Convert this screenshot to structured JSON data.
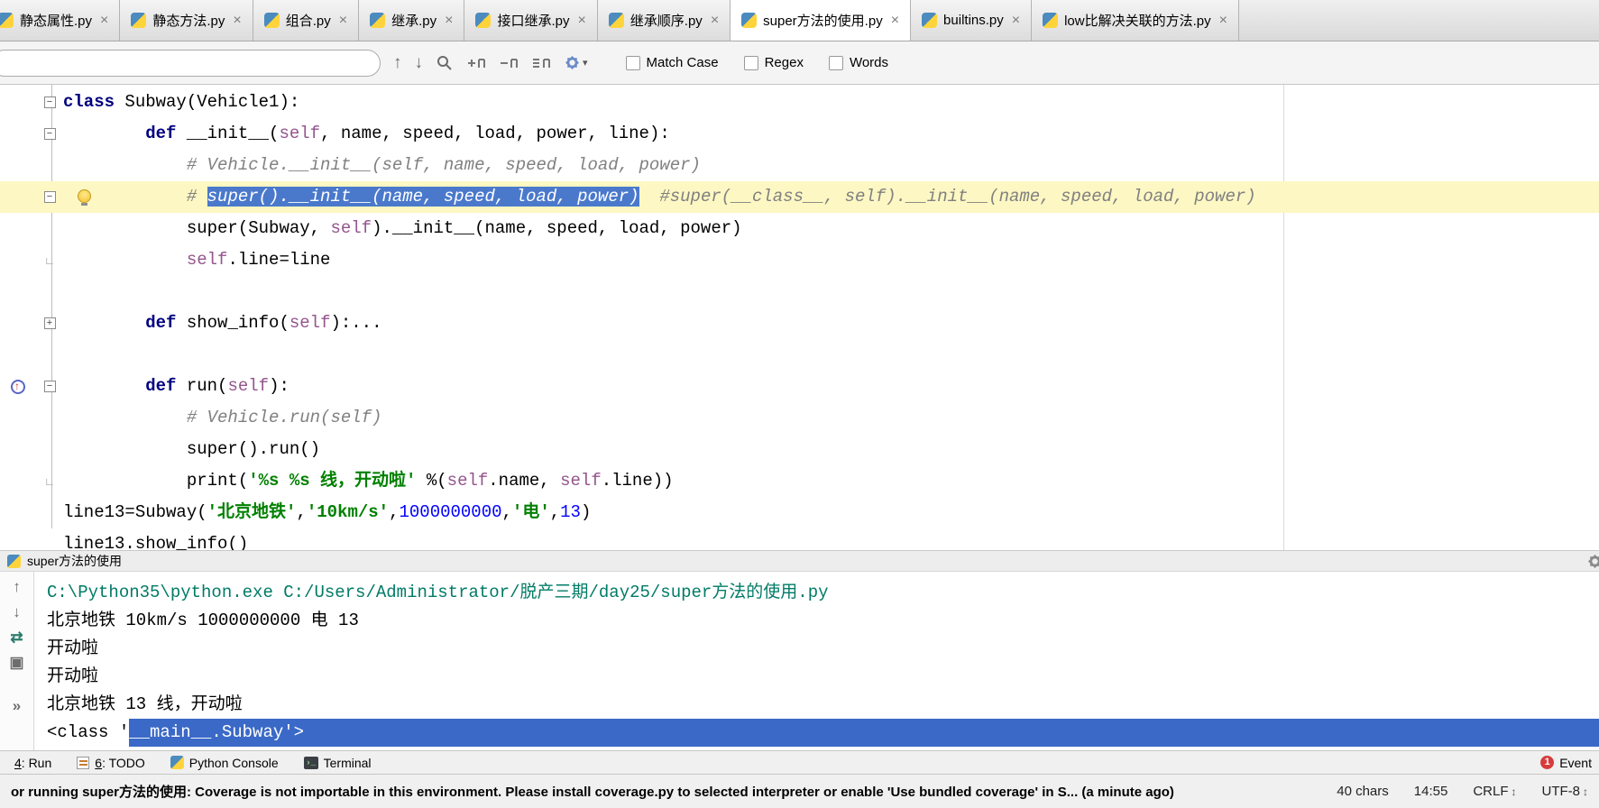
{
  "tabs": [
    {
      "label": "静态属性.py"
    },
    {
      "label": "静态方法.py"
    },
    {
      "label": "组合.py"
    },
    {
      "label": "继承.py"
    },
    {
      "label": "接口继承.py"
    },
    {
      "label": "继承顺序.py"
    },
    {
      "label": "super方法的使用.py"
    },
    {
      "label": "builtins.py"
    },
    {
      "label": "low比解决关联的方法.py"
    }
  ],
  "active_tab_index": 6,
  "find_bar": {
    "query": "",
    "labels": {
      "match_case": "Match Case",
      "regex": "Regex",
      "words": "Words"
    }
  },
  "editor": {
    "lines": [
      {
        "fold": "minus",
        "segs": [
          {
            "t": "class",
            "c": "kw"
          },
          {
            "t": " Subway(Vehicle1):",
            "c": ""
          }
        ]
      },
      {
        "fold": "minus",
        "segs": [
          {
            "t": "        ",
            "c": ""
          },
          {
            "t": "def",
            "c": "kw"
          },
          {
            "t": " __init__(",
            "c": ""
          },
          {
            "t": "self",
            "c": "self"
          },
          {
            "t": ", name, speed, load, power, line):",
            "c": ""
          }
        ]
      },
      {
        "segs": [
          {
            "t": "            ",
            "c": ""
          },
          {
            "t": "# Vehicle.__init__(self, name, speed, load, power)",
            "c": "com"
          }
        ]
      },
      {
        "fold": "minus",
        "hl": true,
        "bulb": true,
        "segs": [
          {
            "t": "            ",
            "c": ""
          },
          {
            "t": "# ",
            "c": "com"
          },
          {
            "t": "super().__init__(name, speed, load, power)",
            "c": "com sel"
          },
          {
            "t": "  ",
            "c": ""
          },
          {
            "t": "#super(__class__, self).__init__(name, speed, load, power)",
            "c": "com"
          }
        ]
      },
      {
        "segs": [
          {
            "t": "            super(Subway, ",
            "c": ""
          },
          {
            "t": "self",
            "c": "self"
          },
          {
            "t": ").__init__(name, speed, load, power)",
            "c": ""
          }
        ]
      },
      {
        "fold": "corner",
        "segs": [
          {
            "t": "            ",
            "c": ""
          },
          {
            "t": "self",
            "c": "self"
          },
          {
            "t": ".line=line",
            "c": ""
          }
        ]
      },
      {
        "segs": []
      },
      {
        "fold": "plus",
        "segs": [
          {
            "t": "        ",
            "c": ""
          },
          {
            "t": "def",
            "c": "kw"
          },
          {
            "t": " show_info(",
            "c": ""
          },
          {
            "t": "self",
            "c": "self"
          },
          {
            "t": "):...",
            "c": ""
          }
        ]
      },
      {
        "segs": []
      },
      {
        "fold": "minus",
        "target": true,
        "segs": [
          {
            "t": "        ",
            "c": ""
          },
          {
            "t": "def",
            "c": "kw"
          },
          {
            "t": " run(",
            "c": ""
          },
          {
            "t": "self",
            "c": "self"
          },
          {
            "t": "):",
            "c": ""
          }
        ]
      },
      {
        "segs": [
          {
            "t": "            ",
            "c": ""
          },
          {
            "t": "# Vehicle.run(self)",
            "c": "com"
          }
        ]
      },
      {
        "segs": [
          {
            "t": "            super().run()",
            "c": ""
          }
        ]
      },
      {
        "fold": "corner",
        "segs": [
          {
            "t": "            print(",
            "c": ""
          },
          {
            "t": "'%s %s 线，开动啦'",
            "c": "str"
          },
          {
            "t": " %(",
            "c": ""
          },
          {
            "t": "self",
            "c": "self"
          },
          {
            "t": ".name, ",
            "c": ""
          },
          {
            "t": "self",
            "c": "self"
          },
          {
            "t": ".line))",
            "c": ""
          }
        ]
      },
      {
        "segs": [
          {
            "t": "line13=Subway(",
            "c": ""
          },
          {
            "t": "'北京地铁'",
            "c": "str"
          },
          {
            "t": ",",
            "c": ""
          },
          {
            "t": "'10km/s'",
            "c": "str"
          },
          {
            "t": ",",
            "c": ""
          },
          {
            "t": "1000000000",
            "c": "num"
          },
          {
            "t": ",",
            "c": ""
          },
          {
            "t": "'电'",
            "c": "str"
          },
          {
            "t": ",",
            "c": ""
          },
          {
            "t": "13",
            "c": "num"
          },
          {
            "t": ")",
            "c": ""
          }
        ]
      },
      {
        "segs": [
          {
            "t": "line13.show_info()",
            "c": ""
          }
        ]
      }
    ]
  },
  "run_panel": {
    "title": "super方法的使用",
    "console": [
      [
        {
          "t": "C:\\Python35\\python.exe C:/Users/Administrator/脱产三期/day25/super方法的使用.py",
          "c": "cmd"
        }
      ],
      [
        {
          "t": "北京地铁 10km/s 1000000000 电 13",
          "c": ""
        }
      ],
      [
        {
          "t": "开动啦",
          "c": ""
        }
      ],
      [
        {
          "t": "开动啦",
          "c": ""
        }
      ],
      [
        {
          "t": "北京地铁 13 线，开动啦",
          "c": ""
        }
      ],
      [
        {
          "t": "<class '",
          "c": ""
        },
        {
          "t": "__main__.Subway'>",
          "c": "csel"
        }
      ]
    ]
  },
  "tool_bar": {
    "run": {
      "u": "4",
      "rest": ": Run"
    },
    "todo": {
      "u": "6",
      "rest": ": TODO"
    },
    "python_console": "Python Console",
    "terminal": "Terminal",
    "event": "Event"
  },
  "status_bar": {
    "message": "or running super方法的使用: Coverage is not importable in this environment. Please install coverage.py to selected interpreter or enable 'Use bundled coverage' in S... (a minute ago)",
    "chars": "40 chars",
    "caret": "14:55",
    "line_sep": "CRLF",
    "encoding": "UTF-8"
  },
  "colors": {
    "editor_selection": "#4A79CC",
    "console_selection": "#3A69C7",
    "line_highlight": "#FDF7C3",
    "keyword": "#000080",
    "string": "#008000",
    "number": "#0000FF",
    "comment": "#808080",
    "self": "#94558D",
    "console_command": "#007B66"
  }
}
